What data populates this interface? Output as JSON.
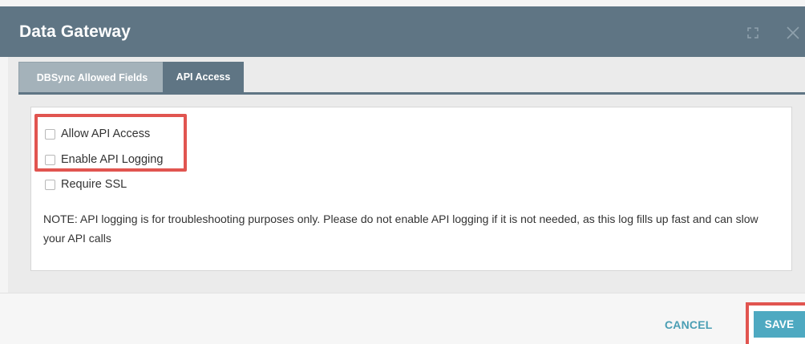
{
  "dialog": {
    "title": "Data Gateway",
    "maximize_icon": "maximize-icon",
    "close_icon": "close-icon"
  },
  "tabs": [
    {
      "label": "DBSync Allowed Fields",
      "active": false
    },
    {
      "label": "API Access",
      "active": true
    }
  ],
  "options": [
    {
      "label": "Allow API Access",
      "checked": false
    },
    {
      "label": "Enable API Logging",
      "checked": false
    },
    {
      "label": "Require SSL",
      "checked": false
    }
  ],
  "note": "NOTE: API logging is for troubleshooting purposes only. Please do not enable API logging if it is not needed, as this log fills up fast and can slow your API calls",
  "footer": {
    "cancel_label": "CANCEL",
    "save_label": "SAVE"
  },
  "colors": {
    "header": "#5f7584",
    "inactive_tab": "#a4b2ba",
    "accent": "#4ea9c1",
    "highlight": "#e15550"
  }
}
